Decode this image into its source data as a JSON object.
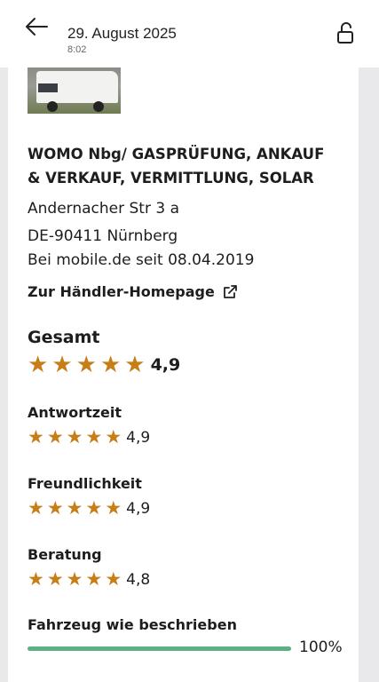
{
  "header": {
    "date": "29. August 2025",
    "time": "8:02"
  },
  "dealer": {
    "name": "WOMO Nbg/ GASPRÜFUNG, ANKAUF & VERKAUF, VERMITTLUNG, SOLAR",
    "street": "Andernacher Str 3 a",
    "city": "DE-90411 Nürnberg",
    "since": "Bei mobile.de seit 08.04.2019",
    "homepage_link": "Zur Händler-Homepage"
  },
  "ratings": {
    "overall": {
      "label": "Gesamt",
      "value": "4,9",
      "stars": 5
    },
    "items": [
      {
        "label": "Antwortzeit",
        "value": "4,9",
        "stars": 5
      },
      {
        "label": "Freundlichkeit",
        "value": "4,9",
        "stars": 5
      },
      {
        "label": "Beratung",
        "value": "4,8",
        "stars": 5
      }
    ],
    "described": {
      "label": "Fahrzeug wie beschrieben",
      "percent_text": "100%",
      "fraction": 1.0
    }
  },
  "colors": {
    "star": "#c77e17",
    "progress": "#5bb084"
  }
}
